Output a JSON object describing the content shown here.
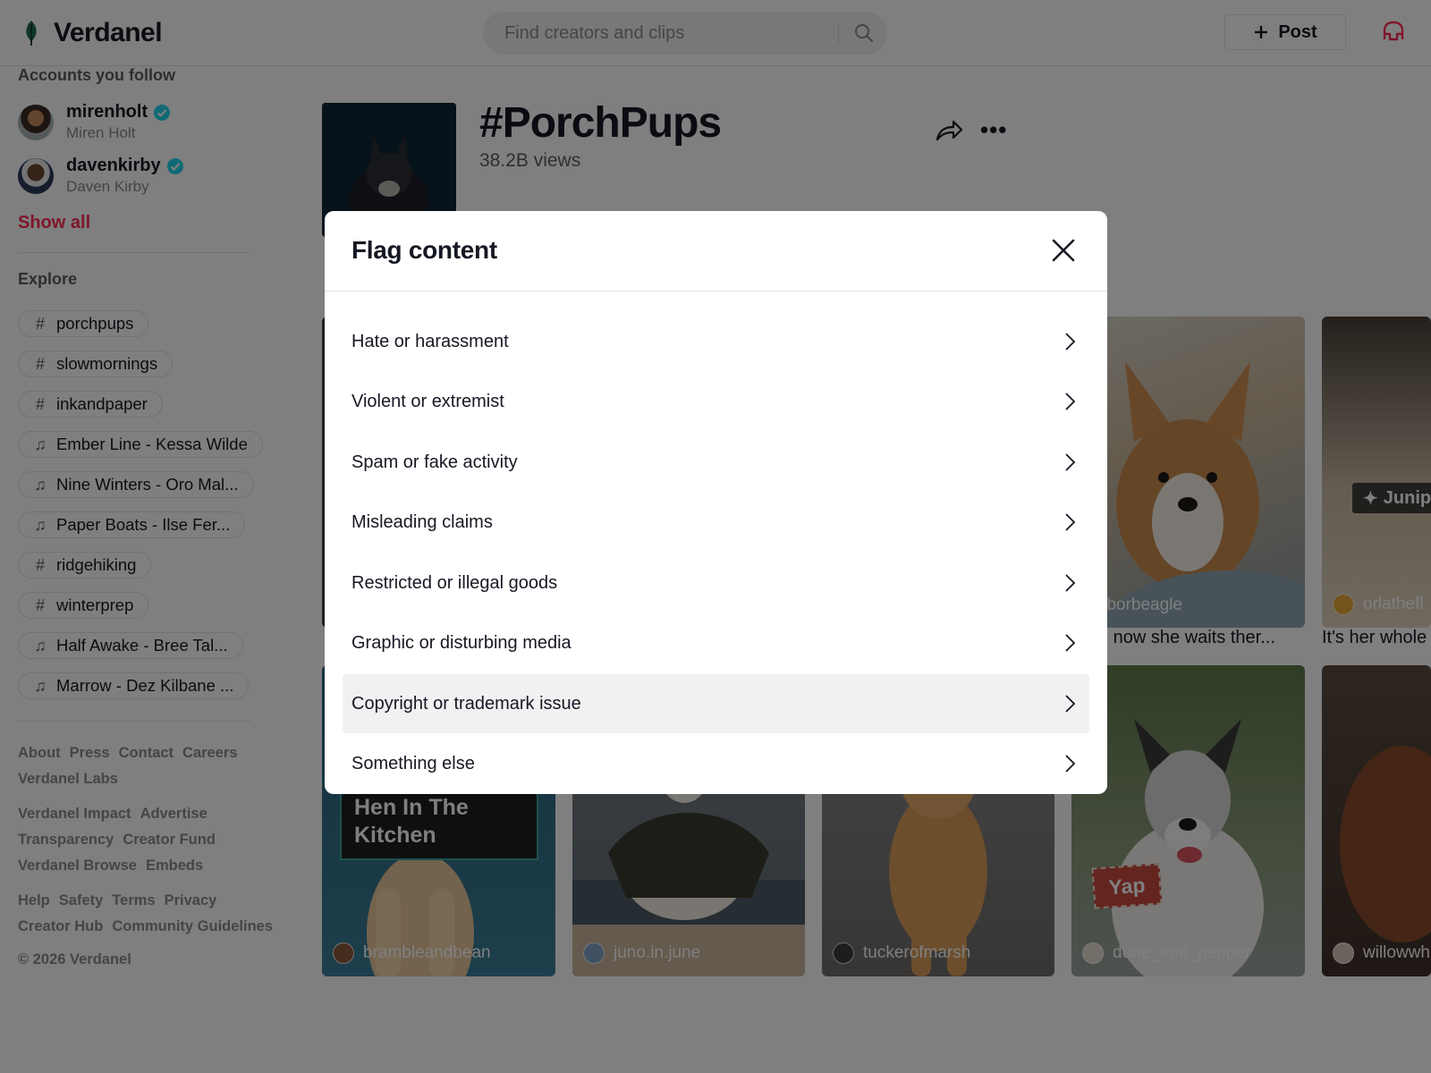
{
  "header": {
    "brand": "Verdanel",
    "search_placeholder": "Find creators and clips",
    "post_label": "Post"
  },
  "sidebar": {
    "following_heading": "Accounts you follow",
    "accounts": [
      {
        "username": "mirenholt",
        "name": "Miren Holt",
        "verified": true
      },
      {
        "username": "davenkirby",
        "name": "Daven Kirby",
        "verified": true
      }
    ],
    "show_all": "Show all",
    "explore_heading": "Explore",
    "explore": [
      {
        "type": "hashtag",
        "label": "porchpups"
      },
      {
        "type": "hashtag",
        "label": "slowmornings"
      },
      {
        "type": "hashtag",
        "label": "inkandpaper"
      },
      {
        "type": "music",
        "label": "Ember Line - Kessa Wilde"
      },
      {
        "type": "music",
        "label": "Nine Winters - Oro Mal..."
      },
      {
        "type": "music",
        "label": "Paper Boats - Ilse Fer..."
      },
      {
        "type": "hashtag",
        "label": "ridgehiking"
      },
      {
        "type": "hashtag",
        "label": "winterprep"
      },
      {
        "type": "music",
        "label": "Half Awake - Bree Tal..."
      },
      {
        "type": "music",
        "label": "Marrow - Dez Kilbane ..."
      }
    ],
    "footer": {
      "row1": [
        "About",
        "Press",
        "Contact",
        "Careers"
      ],
      "row2": [
        "Verdanel Labs"
      ],
      "row3": [
        "Verdanel Impact",
        "Advertise"
      ],
      "row4": [
        "Transparency",
        "Creator Fund"
      ],
      "row5": [
        "Verdanel Browse",
        "Embeds"
      ],
      "row6": [
        "Help",
        "Safety",
        "Terms",
        "Privacy"
      ],
      "row7": [
        "Creator Hub",
        "Community Guidelines"
      ],
      "copyright": "© 2026 Verdanel"
    }
  },
  "main": {
    "tag": "#PorchPups",
    "views": "38.2B views",
    "cards_top": [
      {
        "user": "harborbeagle",
        "caption": "d now she waits ther..."
      },
      {
        "user": "orlathefl",
        "caption": "It's her whole",
        "sticker": "Junip"
      }
    ],
    "cards_bottom": [
      {
        "user": "brambleandbean",
        "sticker": "Hen In The Kitchen"
      },
      {
        "user": "juno.in.june"
      },
      {
        "user": "tuckerofmarsh"
      },
      {
        "user": "dune_and_pepper",
        "sticker": "Yap"
      },
      {
        "user": "willowwh"
      }
    ]
  },
  "modal": {
    "title": "Flag content",
    "options": [
      "Hate or harassment",
      "Violent or extremist",
      "Spam or fake activity",
      "Misleading claims",
      "Restricted or illegal goods",
      "Graphic or disturbing media",
      "Copyright or trademark issue",
      "Something else"
    ],
    "hovered_index": 6
  },
  "colors": {
    "brand_green": "#1f6b57",
    "accent_red": "#fe2c55",
    "verified": "#20d5ec"
  }
}
